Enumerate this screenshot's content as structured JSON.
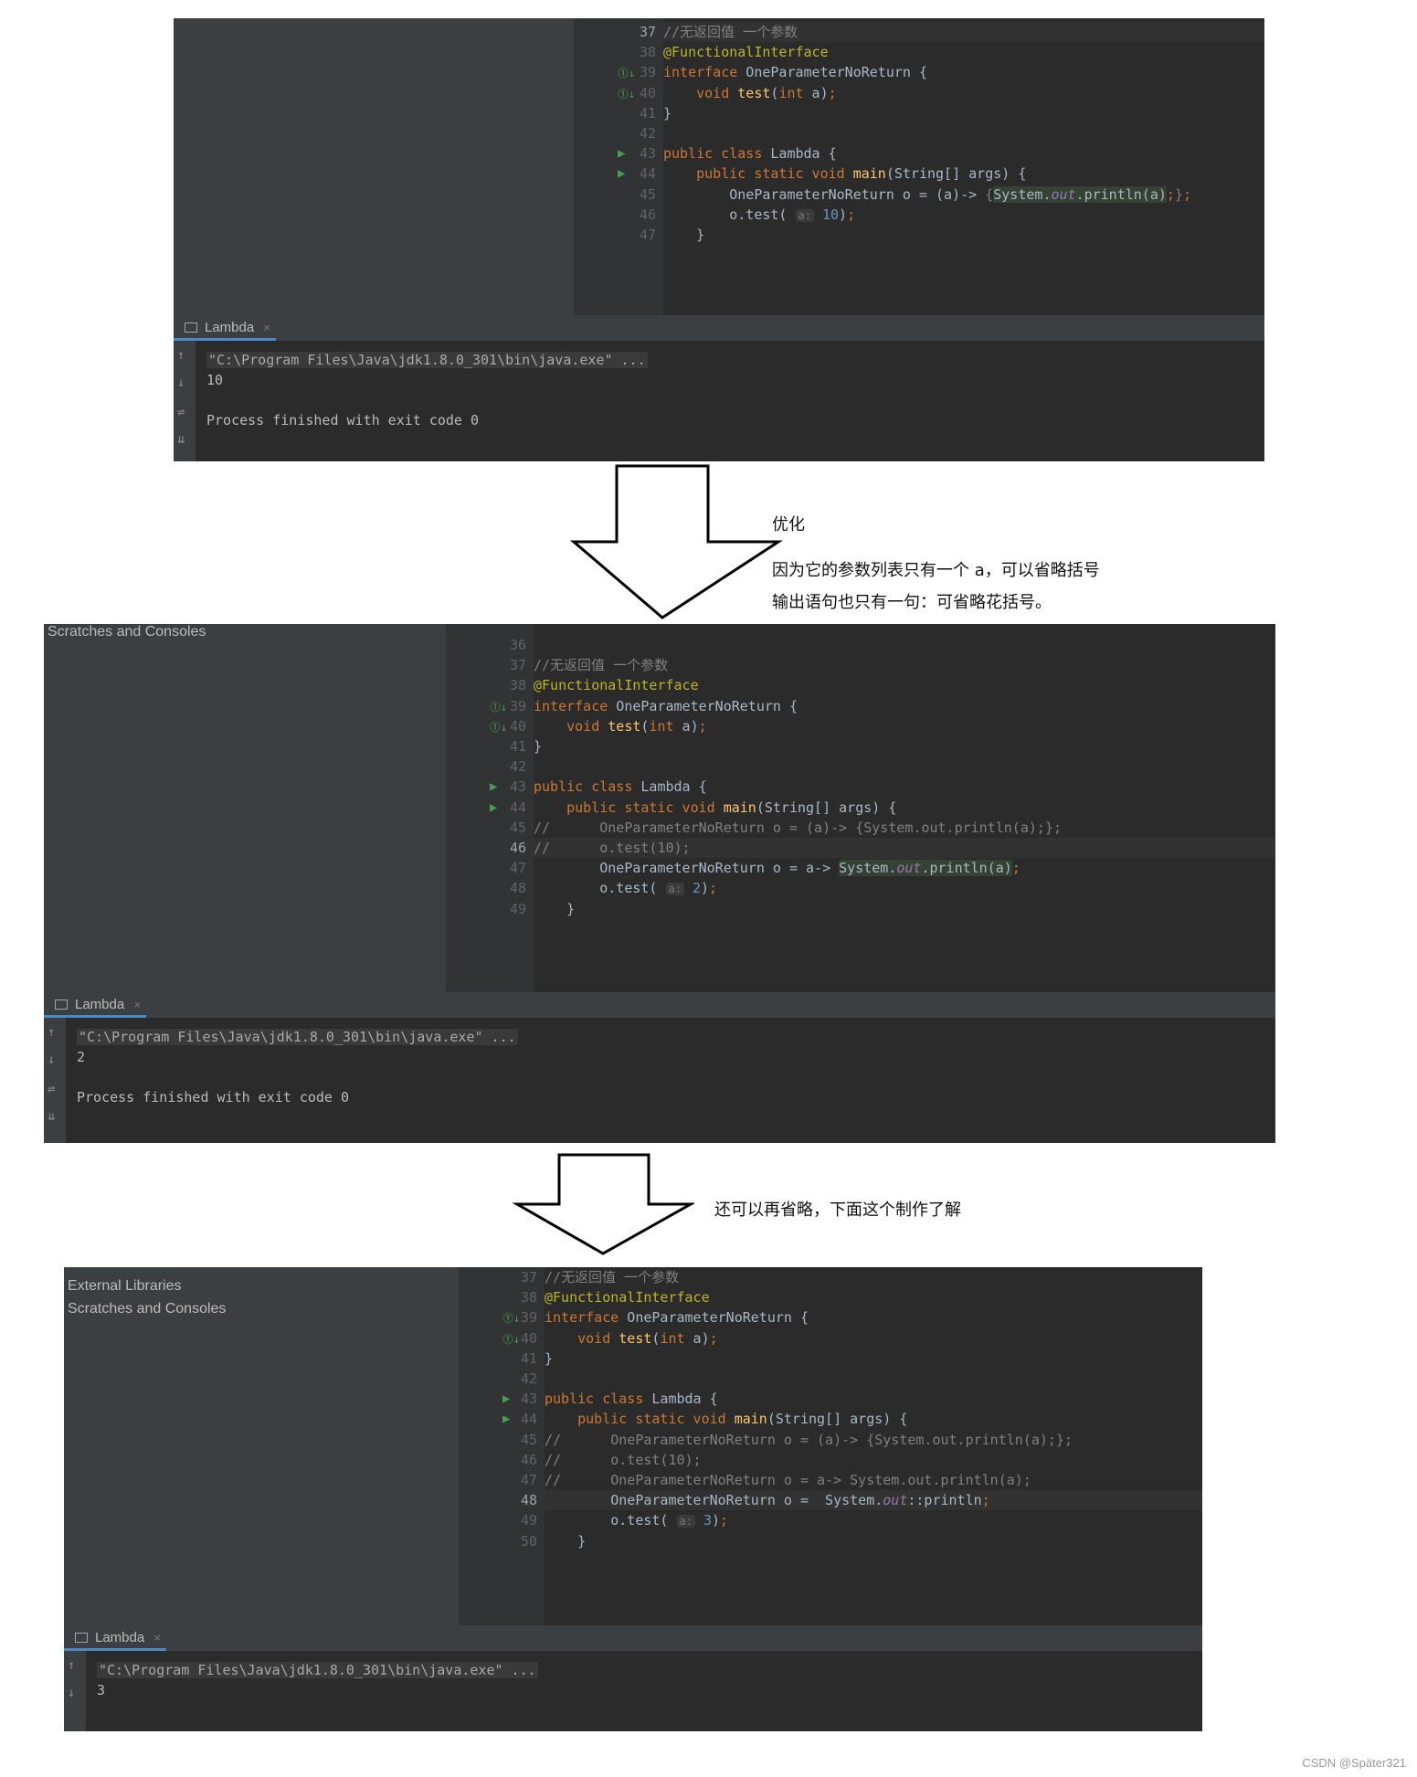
{
  "shot1": {
    "lines": [
      {
        "n": "37",
        "cur": true,
        "html": "<span class=\"cm\">//无返回值 一个参数</span>"
      },
      {
        "n": "38",
        "html": "<span class=\"ann\">@FunctionalInterface</span>"
      },
      {
        "n": "39",
        "html": "<span class=\"k\">interface</span> OneParameterNoReturn {"
      },
      {
        "n": "40",
        "html": "    <span class=\"k\">void</span> <span class=\"fn\">test</span>(<span class=\"k\">int</span> a)<span class=\"k\">;</span>"
      },
      {
        "n": "41",
        "html": "}"
      },
      {
        "n": "42",
        "html": ""
      },
      {
        "n": "43",
        "html": "<span class=\"k\">public class</span> Lambda {"
      },
      {
        "n": "44",
        "html": "    <span class=\"k\">public static void</span> <span class=\"fn\">main</span>(String[] args) {"
      },
      {
        "n": "45",
        "html": "        OneParameterNoReturn o = (a)-> <span class=\"cm\">{</span><span class=\"lbl\">System.<span class=\"st\">out</span>.println(a)</span><span class=\"k\">;</span><span class=\"cm\">}</span><span class=\"k\">;</span>"
      },
      {
        "n": "46",
        "html": "        o.test( <span class=\"hint\">a:</span> <span class=\"num\">10</span>)<span class=\"k\">;</span>"
      },
      {
        "n": "47",
        "html": "    }"
      }
    ],
    "tab_label": "Lambda",
    "output": [
      "\"C:\\Program Files\\Java\\jdk1.8.0_301\\bin\\java.exe\" ...",
      "10",
      "",
      "Process finished with exit code 0"
    ]
  },
  "note1": {
    "title": "优化",
    "line1": "因为它的参数列表只有一个 a，可以省略括号",
    "line2": "输出语句也只有一句：可省略花括号。"
  },
  "shot2": {
    "project_items": [
      "Scratches and Consoles"
    ],
    "lines": [
      {
        "n": "36",
        "html": ""
      },
      {
        "n": "37",
        "html": "<span class=\"cm\">//无返回值 一个参数</span>"
      },
      {
        "n": "38",
        "html": "<span class=\"ann\">@FunctionalInterface</span>"
      },
      {
        "n": "39",
        "html": "<span class=\"k\">interface</span> OneParameterNoReturn {"
      },
      {
        "n": "40",
        "html": "    <span class=\"k\">void</span> <span class=\"fn\">test</span>(<span class=\"k\">int</span> a)<span class=\"k\">;</span>"
      },
      {
        "n": "41",
        "html": "}"
      },
      {
        "n": "42",
        "html": ""
      },
      {
        "n": "43",
        "html": "<span class=\"k\">public class</span> Lambda {"
      },
      {
        "n": "44",
        "html": "    <span class=\"k\">public static void</span> <span class=\"fn\">main</span>(String[] args) {"
      },
      {
        "n": "45",
        "html": "<span class=\"cm\">//      OneParameterNoReturn o = (a)-> {System.out.println(a);};</span>"
      },
      {
        "n": "46",
        "cur": true,
        "html": "<span class=\"cm\">//      o.test(10);</span>"
      },
      {
        "n": "47",
        "html": "        OneParameterNoReturn o = a-> <span class=\"lbl\">System.<span class=\"st\">out</span>.println(a)</span><span class=\"k\">;</span>"
      },
      {
        "n": "48",
        "html": "        o.test( <span class=\"hint\">a:</span> <span class=\"num\">2</span>)<span class=\"k\">;</span>"
      },
      {
        "n": "49",
        "html": "    }"
      }
    ],
    "tab_label": "Lambda",
    "output": [
      "\"C:\\Program Files\\Java\\jdk1.8.0_301\\bin\\java.exe\" ...",
      "2",
      "",
      "Process finished with exit code 0"
    ]
  },
  "note2": {
    "text": "还可以再省略，下面这个制作了解"
  },
  "shot3": {
    "project_items": [
      "External Libraries",
      "Scratches and Consoles"
    ],
    "lines": [
      {
        "n": "37",
        "html": "<span class=\"cm\">//无返回值 一个参数</span>"
      },
      {
        "n": "38",
        "html": "<span class=\"ann\">@FunctionalInterface</span>"
      },
      {
        "n": "39",
        "html": "<span class=\"k\">interface</span> OneParameterNoReturn {"
      },
      {
        "n": "40",
        "html": "    <span class=\"k\">void</span> <span class=\"fn\">test</span>(<span class=\"k\">int</span> a)<span class=\"k\">;</span>"
      },
      {
        "n": "41",
        "html": "}"
      },
      {
        "n": "42",
        "html": ""
      },
      {
        "n": "43",
        "html": "<span class=\"k\">public class</span> Lambda {"
      },
      {
        "n": "44",
        "html": "    <span class=\"k\">public static void</span> <span class=\"fn\">main</span>(String[] args) {"
      },
      {
        "n": "45",
        "html": "<span class=\"cm\">//      OneParameterNoReturn o = (a)-> {System.out.println(a);};</span>"
      },
      {
        "n": "46",
        "html": "<span class=\"cm\">//      o.test(10);</span>"
      },
      {
        "n": "47",
        "html": "<span class=\"cm\">//      OneParameterNoReturn o = a-> System.out.println(a);</span>"
      },
      {
        "n": "48",
        "cur": true,
        "html": "        OneParameterNoReturn o =  System.<span class=\"st\">out</span>::println<span class=\"k\">;</span>"
      },
      {
        "n": "49",
        "html": "        o.test( <span class=\"hint\">a:</span> <span class=\"num\">3</span>)<span class=\"k\">;</span>"
      },
      {
        "n": "50",
        "html": "    }"
      }
    ],
    "tab_label": "Lambda",
    "output": [
      "\"C:\\Program Files\\Java\\jdk1.8.0_301\\bin\\java.exe\" ...",
      "3"
    ]
  },
  "watermark": "CSDN @Später321"
}
